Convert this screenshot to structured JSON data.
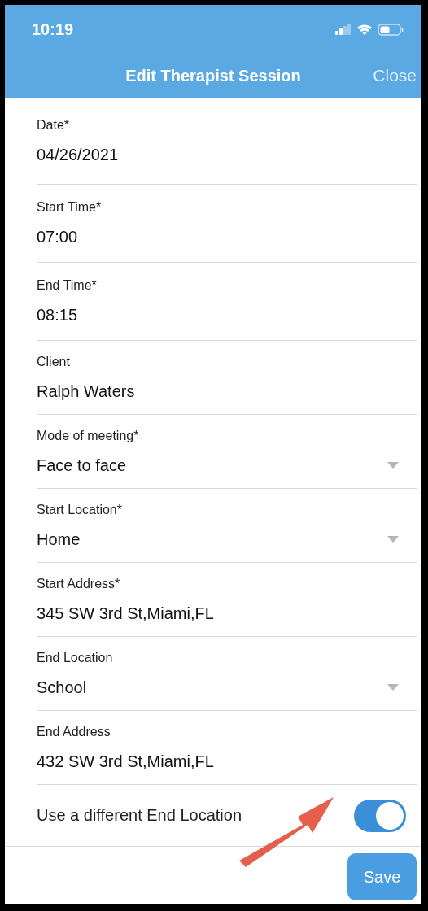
{
  "status_bar": {
    "time": "10:19"
  },
  "header": {
    "title": "Edit Therapist Session",
    "close": "Close"
  },
  "fields": [
    {
      "kind": "text",
      "label": "Date*",
      "value": "04/26/2021"
    },
    {
      "kind": "text",
      "label": "Start Time*",
      "value": "07:00"
    },
    {
      "kind": "text",
      "label": "End Time*",
      "value": "08:15"
    },
    {
      "kind": "text",
      "label": "Client",
      "value": "Ralph Waters"
    },
    {
      "kind": "dropdown",
      "label": "Mode of meeting*",
      "value": "Face to face"
    },
    {
      "kind": "dropdown",
      "label": "Start Location*",
      "value": "Home"
    },
    {
      "kind": "text",
      "label": "Start Address*",
      "value": "345 SW 3rd St,Miami,FL"
    },
    {
      "kind": "dropdown",
      "label": "End Location",
      "value": "School"
    },
    {
      "kind": "text",
      "label": "End Address",
      "value": "432 SW 3rd St,Miami,FL"
    }
  ],
  "toggle": {
    "label": "Use a different End Location",
    "on": true
  },
  "save": "Save"
}
